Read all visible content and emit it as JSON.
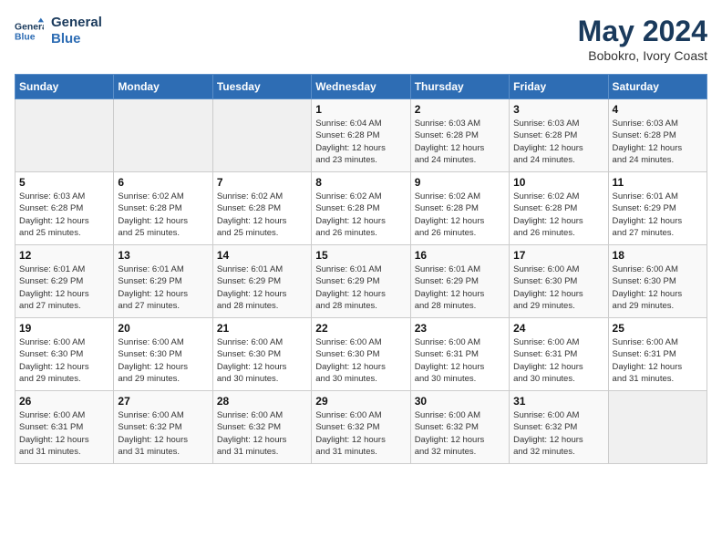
{
  "logo": {
    "line1": "General",
    "line2": "Blue"
  },
  "title": "May 2024",
  "subtitle": "Bobokro, Ivory Coast",
  "days_header": [
    "Sunday",
    "Monday",
    "Tuesday",
    "Wednesday",
    "Thursday",
    "Friday",
    "Saturday"
  ],
  "weeks": [
    [
      {
        "num": "",
        "info": ""
      },
      {
        "num": "",
        "info": ""
      },
      {
        "num": "",
        "info": ""
      },
      {
        "num": "1",
        "info": "Sunrise: 6:04 AM\nSunset: 6:28 PM\nDaylight: 12 hours\nand 23 minutes."
      },
      {
        "num": "2",
        "info": "Sunrise: 6:03 AM\nSunset: 6:28 PM\nDaylight: 12 hours\nand 24 minutes."
      },
      {
        "num": "3",
        "info": "Sunrise: 6:03 AM\nSunset: 6:28 PM\nDaylight: 12 hours\nand 24 minutes."
      },
      {
        "num": "4",
        "info": "Sunrise: 6:03 AM\nSunset: 6:28 PM\nDaylight: 12 hours\nand 24 minutes."
      }
    ],
    [
      {
        "num": "5",
        "info": "Sunrise: 6:03 AM\nSunset: 6:28 PM\nDaylight: 12 hours\nand 25 minutes."
      },
      {
        "num": "6",
        "info": "Sunrise: 6:02 AM\nSunset: 6:28 PM\nDaylight: 12 hours\nand 25 minutes."
      },
      {
        "num": "7",
        "info": "Sunrise: 6:02 AM\nSunset: 6:28 PM\nDaylight: 12 hours\nand 25 minutes."
      },
      {
        "num": "8",
        "info": "Sunrise: 6:02 AM\nSunset: 6:28 PM\nDaylight: 12 hours\nand 26 minutes."
      },
      {
        "num": "9",
        "info": "Sunrise: 6:02 AM\nSunset: 6:28 PM\nDaylight: 12 hours\nand 26 minutes."
      },
      {
        "num": "10",
        "info": "Sunrise: 6:02 AM\nSunset: 6:28 PM\nDaylight: 12 hours\nand 26 minutes."
      },
      {
        "num": "11",
        "info": "Sunrise: 6:01 AM\nSunset: 6:29 PM\nDaylight: 12 hours\nand 27 minutes."
      }
    ],
    [
      {
        "num": "12",
        "info": "Sunrise: 6:01 AM\nSunset: 6:29 PM\nDaylight: 12 hours\nand 27 minutes."
      },
      {
        "num": "13",
        "info": "Sunrise: 6:01 AM\nSunset: 6:29 PM\nDaylight: 12 hours\nand 27 minutes."
      },
      {
        "num": "14",
        "info": "Sunrise: 6:01 AM\nSunset: 6:29 PM\nDaylight: 12 hours\nand 28 minutes."
      },
      {
        "num": "15",
        "info": "Sunrise: 6:01 AM\nSunset: 6:29 PM\nDaylight: 12 hours\nand 28 minutes."
      },
      {
        "num": "16",
        "info": "Sunrise: 6:01 AM\nSunset: 6:29 PM\nDaylight: 12 hours\nand 28 minutes."
      },
      {
        "num": "17",
        "info": "Sunrise: 6:00 AM\nSunset: 6:30 PM\nDaylight: 12 hours\nand 29 minutes."
      },
      {
        "num": "18",
        "info": "Sunrise: 6:00 AM\nSunset: 6:30 PM\nDaylight: 12 hours\nand 29 minutes."
      }
    ],
    [
      {
        "num": "19",
        "info": "Sunrise: 6:00 AM\nSunset: 6:30 PM\nDaylight: 12 hours\nand 29 minutes."
      },
      {
        "num": "20",
        "info": "Sunrise: 6:00 AM\nSunset: 6:30 PM\nDaylight: 12 hours\nand 29 minutes."
      },
      {
        "num": "21",
        "info": "Sunrise: 6:00 AM\nSunset: 6:30 PM\nDaylight: 12 hours\nand 30 minutes."
      },
      {
        "num": "22",
        "info": "Sunrise: 6:00 AM\nSunset: 6:30 PM\nDaylight: 12 hours\nand 30 minutes."
      },
      {
        "num": "23",
        "info": "Sunrise: 6:00 AM\nSunset: 6:31 PM\nDaylight: 12 hours\nand 30 minutes."
      },
      {
        "num": "24",
        "info": "Sunrise: 6:00 AM\nSunset: 6:31 PM\nDaylight: 12 hours\nand 30 minutes."
      },
      {
        "num": "25",
        "info": "Sunrise: 6:00 AM\nSunset: 6:31 PM\nDaylight: 12 hours\nand 31 minutes."
      }
    ],
    [
      {
        "num": "26",
        "info": "Sunrise: 6:00 AM\nSunset: 6:31 PM\nDaylight: 12 hours\nand 31 minutes."
      },
      {
        "num": "27",
        "info": "Sunrise: 6:00 AM\nSunset: 6:32 PM\nDaylight: 12 hours\nand 31 minutes."
      },
      {
        "num": "28",
        "info": "Sunrise: 6:00 AM\nSunset: 6:32 PM\nDaylight: 12 hours\nand 31 minutes."
      },
      {
        "num": "29",
        "info": "Sunrise: 6:00 AM\nSunset: 6:32 PM\nDaylight: 12 hours\nand 31 minutes."
      },
      {
        "num": "30",
        "info": "Sunrise: 6:00 AM\nSunset: 6:32 PM\nDaylight: 12 hours\nand 32 minutes."
      },
      {
        "num": "31",
        "info": "Sunrise: 6:00 AM\nSunset: 6:32 PM\nDaylight: 12 hours\nand 32 minutes."
      },
      {
        "num": "",
        "info": ""
      }
    ]
  ]
}
